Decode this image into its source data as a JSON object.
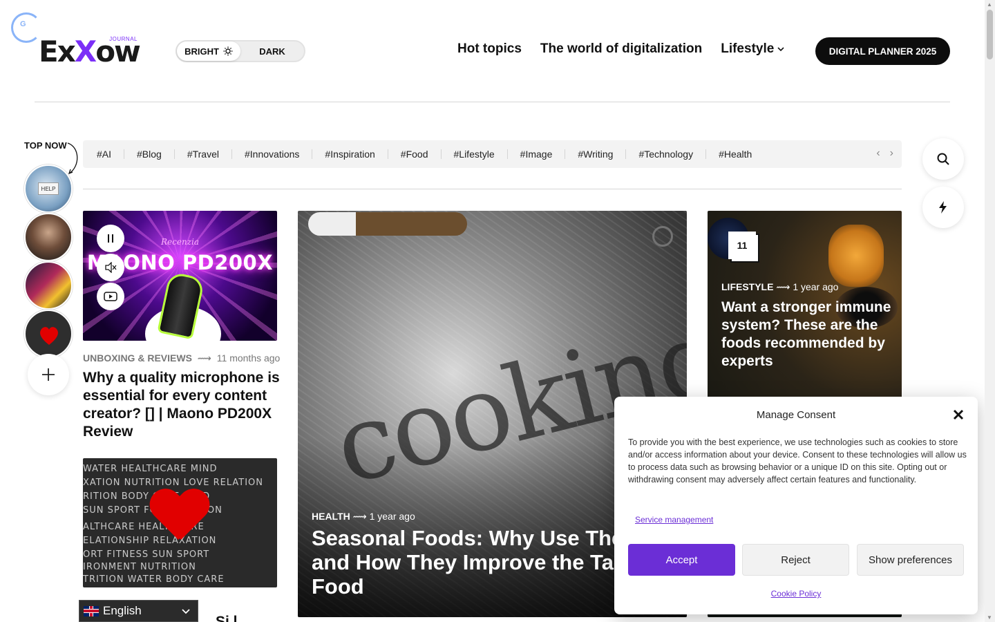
{
  "header": {
    "logo_text_1": "E",
    "logo_text_2": "x",
    "logo_text_3": "X",
    "logo_text_4": "ow",
    "logo_journal": "JOURNAL",
    "theme": {
      "bright": "BRIGHT",
      "dark": "DARK",
      "active": "bright"
    },
    "nav": [
      {
        "label": "Hot topics"
      },
      {
        "label": "The world of digitalization"
      },
      {
        "label": "Lifestyle",
        "has_dropdown": true
      }
    ],
    "cta": "DIGITAL PLANNER 2025"
  },
  "top_now": {
    "label": "TOP NOW",
    "stories_count": 4
  },
  "tags": [
    "#AI",
    "#Blog",
    "#Travel",
    "#Innovations",
    "#Inspiration",
    "#Food",
    "#Lifestyle",
    "#Image",
    "#Writing",
    "#Technology",
    "#Health"
  ],
  "posts": {
    "left_1": {
      "image_heading": "MAONO PD200X",
      "image_sub": "Recenzia",
      "category": "UNBOXING & REVIEWS",
      "separator": "⟿",
      "time": "11 months ago",
      "title": "Why a quality microphone is essential for every content creator? [] | Maono PD200X Review"
    },
    "left_2": {
      "chalk_lines": [
        "WATER  HEALTHCARE  MIND",
        "XATION  NUTRITION LOVE  RELATION",
        "RITION  BODY CARE  MIND",
        "SUN  SPORT  FOOD  ENVIRON",
        "ALTHCARE  HEALTHCARE",
        "ELATIONSHIP  RELAXATION",
        "ORT FITNESS  SUN SPORT",
        "IRONMENT  NUTRITION",
        "TRITION  WATER  BODY CARE"
      ],
      "partial_title": "Si  l"
    },
    "hero": {
      "image_word": "cooking",
      "category": "HEALTH",
      "separator": "⟿",
      "time": "1 year ago",
      "title": "Seasonal Foods: Why Use Them and How They Improve the Taste of Food"
    },
    "right": {
      "badge_count": "11",
      "category": "LIFESTYLE",
      "separator": "⟿",
      "time": "1 year ago",
      "title": "Want a stronger immune system? These are the foods recommended by experts"
    }
  },
  "language": {
    "selected": "English",
    "flag": "uk-flag"
  },
  "consent": {
    "title": "Manage Consent",
    "body": "To provide you with the best experience, we use technologies such as cookies to store and/or access information about your device. Consent to these technologies will allow us to process data such as browsing behavior or a unique ID on this site. Opting out or withdrawing consent may adversely affect certain features and functionality.",
    "service_link": "Service management",
    "accept": "Accept",
    "reject": "Reject",
    "preferences": "Show preferences",
    "policy_link": "Cookie Policy"
  },
  "colors": {
    "accent": "#6b2ed6",
    "cta_bg": "#0d0d0d",
    "tag_bar_bg": "#f3f3f3"
  },
  "icons": {
    "sun": "sun-icon",
    "chevron": "chevron-down-icon",
    "search": "search-icon",
    "bolt": "lightning-icon",
    "pause": "pause-icon",
    "mute": "mute-icon",
    "youtube": "youtube-icon",
    "close": "close-icon",
    "add": "plus-icon"
  }
}
